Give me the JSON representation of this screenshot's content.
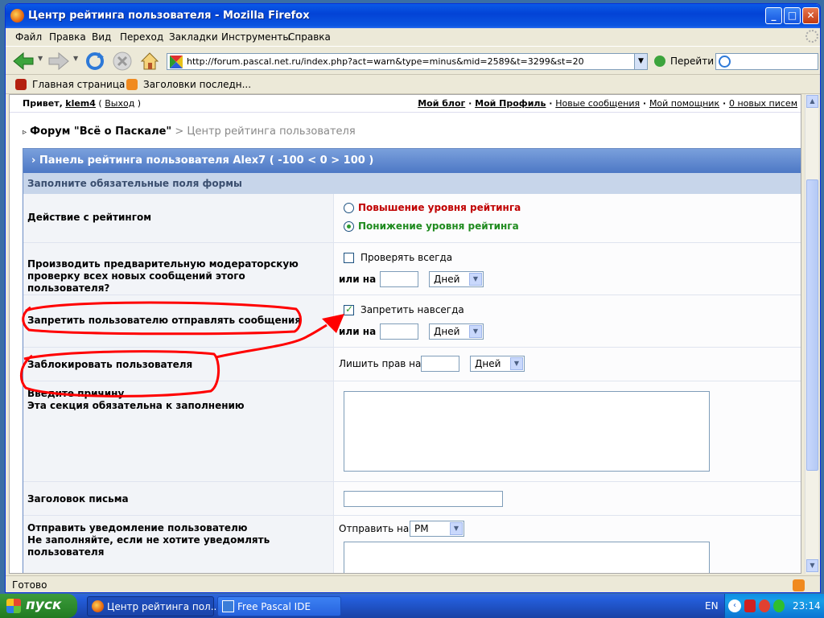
{
  "window": {
    "title": "Центр рейтинга пользователя - Mozilla Firefox",
    "minimize": "_",
    "maximize": "□",
    "close": "✕"
  },
  "menu": [
    "Файл",
    "Правка",
    "Вид",
    "Переход",
    "Закладки",
    "Инструменты",
    "Справка"
  ],
  "nav": {
    "url": "http://forum.pascal.net.ru/index.php?act=warn&type=minus&mid=2589&t=3299&st=20",
    "go_label": "Перейти",
    "dropdown": "▼"
  },
  "bookmarks": [
    "Главная страница ...",
    "Заголовки последн..."
  ],
  "userbar": {
    "greeting": "Привет,",
    "username": "klem4",
    "logout": "Выход",
    "links": [
      "Мой блог",
      "Мой Профиль",
      "Новые сообщения",
      "Мой помощник",
      "0 новых писем"
    ]
  },
  "breadcrumb": {
    "arrow": "▹",
    "forum": "Форум \"Всё о Паскале\"",
    "sep": ">",
    "current": "Центр рейтинга пользователя"
  },
  "panel": {
    "title": "› Панель рейтинга пользователя Alex7 ( -100 < 0 > 100 )",
    "note": "Заполните обязательные поля формы",
    "action_label": "Действие с рейтингом",
    "raise": "Повышение уровня рейтинга",
    "lower": "Понижение уровня рейтинга",
    "lower_selected": true,
    "moderate_label": "Производить предварительную модераторскую проверку всех новых сообщений этого пользователя?",
    "moderate_always": "Проверять всегда",
    "or_on": "или на",
    "days": "Дней",
    "forbid_label": "Запретить пользователю отправлять сообщения",
    "forbid_forever": "Запретить навсегда",
    "forbid_checked": true,
    "block_label": "Заблокировать пользователя",
    "revoke_on": "Лишить прав на",
    "reason_label_1": "Введите причину",
    "reason_label_2": "Эта секция обязательна к заполнению",
    "subject_label": "Заголовок письма",
    "notify_label_1": "Отправить уведомление пользователю",
    "notify_label_2": "Не заполняйте, если не хотите уведомлять пользователя",
    "send_on": "Отправить на",
    "send_method": "PM"
  },
  "status": "Готово",
  "taskbar": {
    "start": "пуск",
    "tasks": [
      "Центр рейтинга пол...",
      "Free Pascal IDE"
    ],
    "lang": "EN",
    "time": "23:14"
  },
  "colors": {
    "raise": "#c00000",
    "lower": "#1f8b1f",
    "annotation": "#ff0000"
  }
}
